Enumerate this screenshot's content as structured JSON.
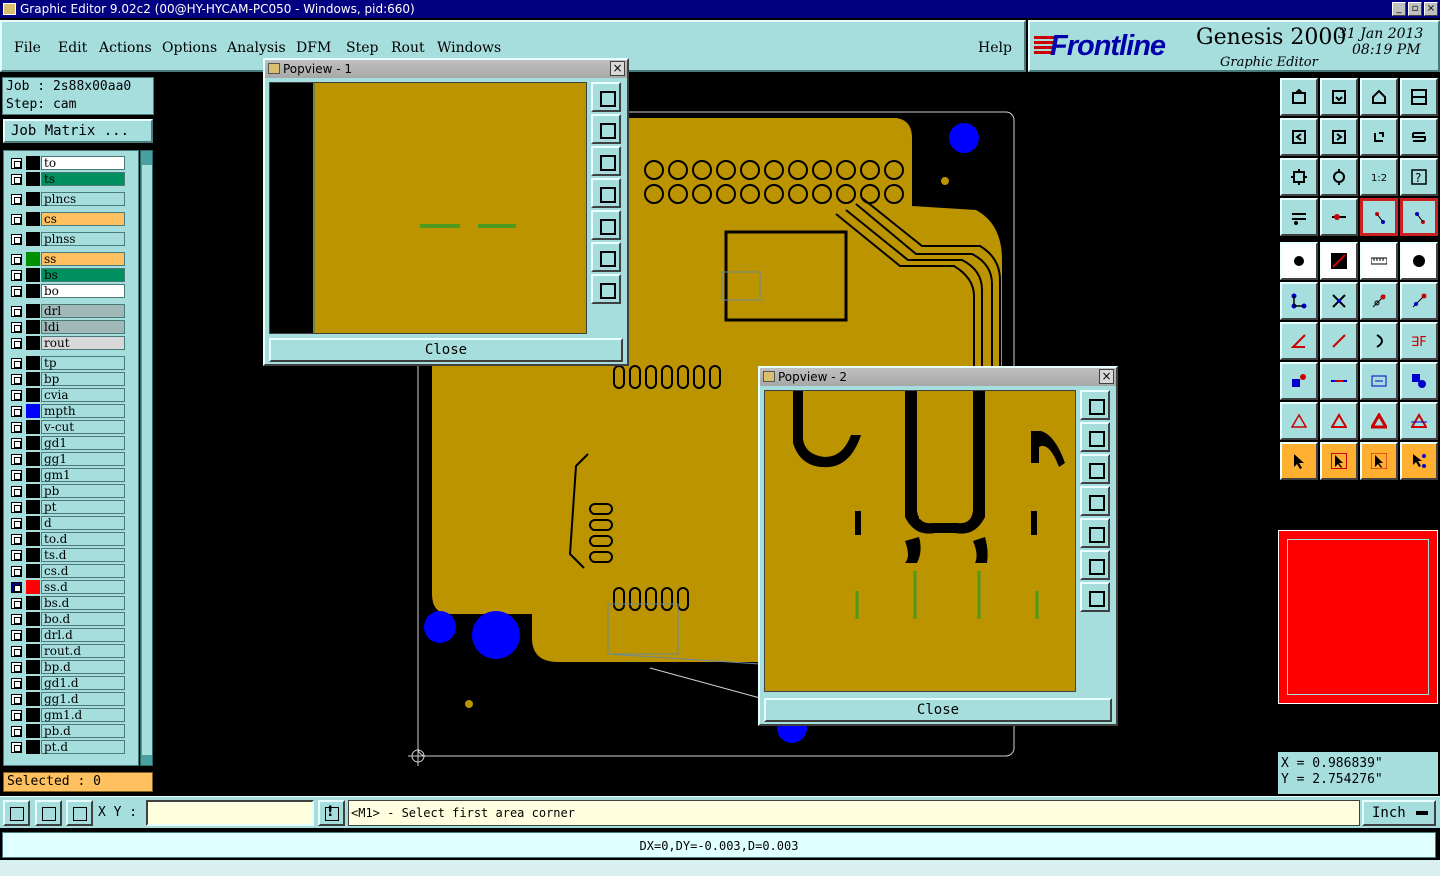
{
  "window": {
    "title": "Graphic Editor 9.02c2 (00@HY-HYCAM-PC050 - Windows, pid:660)"
  },
  "menu": {
    "items": [
      "File",
      "Edit",
      "Actions",
      "Options",
      "Analysis",
      "DFM",
      "Step",
      "Rout",
      "Windows"
    ],
    "help": "Help"
  },
  "brand": {
    "logo": "Frontline",
    "product": "Genesis 2000",
    "subtitle": "Graphic Editor",
    "date": "31 Jan 2013",
    "time": "08:19 PM"
  },
  "job": {
    "job_line": "Job : 2s88x00aa0",
    "step_line": "Step: cam",
    "matrix_button": "Job Matrix ..."
  },
  "layers": [
    {
      "name": "to",
      "color": "#ffffff"
    },
    {
      "name": "ts",
      "color": "#009060"
    },
    {
      "name": "plncs",
      "color": "#a6dede"
    },
    {
      "name": "cs",
      "color": "#ffc060"
    },
    {
      "name": "plnss",
      "color": "#a6dede"
    },
    {
      "name": "ss",
      "color": "#ffc060",
      "swatch": "#009000"
    },
    {
      "name": "bs",
      "color": "#009060"
    },
    {
      "name": "bo",
      "color": "#ffffff"
    },
    {
      "name": "drl",
      "color": "#a0b8b8"
    },
    {
      "name": "ldi",
      "color": "#a0b8b8"
    },
    {
      "name": "rout",
      "color": "#d8d8d8"
    },
    {
      "name": "tp",
      "color": "#a6dede"
    },
    {
      "name": "bp",
      "color": "#a6dede"
    },
    {
      "name": "cvia",
      "color": "#a6dede"
    },
    {
      "name": "mpth",
      "color": "#a6dede",
      "swatch": "#0000ff"
    },
    {
      "name": "v-cut",
      "color": "#a6dede"
    },
    {
      "name": "gd1",
      "color": "#a6dede"
    },
    {
      "name": "gg1",
      "color": "#a6dede"
    },
    {
      "name": "gm1",
      "color": "#a6dede"
    },
    {
      "name": "pb",
      "color": "#a6dede"
    },
    {
      "name": "pt",
      "color": "#a6dede"
    },
    {
      "name": "d",
      "color": "#a6dede"
    },
    {
      "name": "to.d",
      "color": "#a6dede"
    },
    {
      "name": "ts.d",
      "color": "#a6dede"
    },
    {
      "name": "cs.d",
      "color": "#a6dede"
    },
    {
      "name": "ss.d",
      "color": "#a6dede",
      "swatch": "#ff0000",
      "checked": true
    },
    {
      "name": "bs.d",
      "color": "#a6dede"
    },
    {
      "name": "bo.d",
      "color": "#a6dede"
    },
    {
      "name": "drl.d",
      "color": "#a6dede"
    },
    {
      "name": "rout.d",
      "color": "#a6dede"
    },
    {
      "name": "bp.d",
      "color": "#a6dede"
    },
    {
      "name": "gd1.d",
      "color": "#a6dede"
    },
    {
      "name": "gg1.d",
      "color": "#a6dede"
    },
    {
      "name": "gm1.d",
      "color": "#a6dede"
    },
    {
      "name": "pb.d",
      "color": "#a6dede"
    },
    {
      "name": "pt.d",
      "color": "#a6dede"
    }
  ],
  "selected": "Selected : 0",
  "popview1": {
    "title": "Popview - 1",
    "close": "Close"
  },
  "popview2": {
    "title": "Popview - 2",
    "close": "Close"
  },
  "coords": {
    "x": "X = 0.986839\"",
    "y": "Y = 2.754276\""
  },
  "command": {
    "xy_label": "X Y :",
    "xy_value": "",
    "prompt": "<M1> - Select first area corner",
    "unit": "Inch"
  },
  "status": "DX=0,DY=-0.003,D=0.003",
  "colors": {
    "panel": "#a6dede",
    "board": "#bc9400",
    "hole": "#0000ff",
    "overview": "#ff0000"
  }
}
